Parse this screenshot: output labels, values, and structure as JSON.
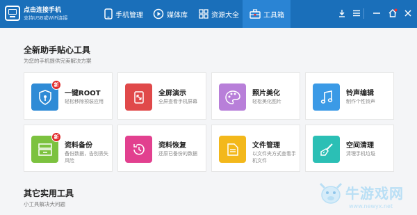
{
  "app": {
    "title": "点击连接手机",
    "subtitle": "支持USB或WiFi连接"
  },
  "nav": [
    {
      "label": "手机管理",
      "icon": "phone-icon"
    },
    {
      "label": "媒体库",
      "icon": "play-icon"
    },
    {
      "label": "资源大全",
      "icon": "grid-icon"
    },
    {
      "label": "工具箱",
      "icon": "toolbox-icon",
      "active": true
    }
  ],
  "window_controls": [
    "download-icon",
    "menu-icon",
    "minimize-icon",
    "home-icon",
    "close-icon"
  ],
  "section1": {
    "title": "全新助手贴心工具",
    "subtitle": "为您的手机提供完美解决方案"
  },
  "tools": [
    {
      "name": "一键ROOT",
      "desc": "轻松移除预装应用",
      "color": "#2f8bd6",
      "icon": "shield-icon",
      "badge": "新"
    },
    {
      "name": "全屏演示",
      "desc": "全屏查看手机屏幕",
      "color": "#e0494a",
      "icon": "fullscreen-icon"
    },
    {
      "name": "照片美化",
      "desc": "轻松美化图片",
      "color": "#b87fd9",
      "icon": "palette-icon"
    },
    {
      "name": "铃声编辑",
      "desc": "制作个性铃声",
      "color": "#3b9ae6",
      "icon": "music-note-icon"
    },
    {
      "name": "资料备份",
      "desc": "备份数据，告别丢失风险",
      "color": "#7cc23f",
      "icon": "backup-icon",
      "badge": "新"
    },
    {
      "name": "资料恢复",
      "desc": "还原已备份的数据",
      "color": "#e2408f",
      "icon": "clock-icon"
    },
    {
      "name": "文件管理",
      "desc": "以文件夹方式查看手机文件",
      "color": "#f3b81b",
      "icon": "folder-icon"
    },
    {
      "name": "空间清理",
      "desc": "清理手机垃圾",
      "color": "#2bbfb5",
      "icon": "brush-icon"
    }
  ],
  "section2": {
    "title": "其它实用工具",
    "subtitle": "小工具解决大问题"
  },
  "watermark": {
    "text": "牛游戏网",
    "url": "www.newyx.net"
  }
}
